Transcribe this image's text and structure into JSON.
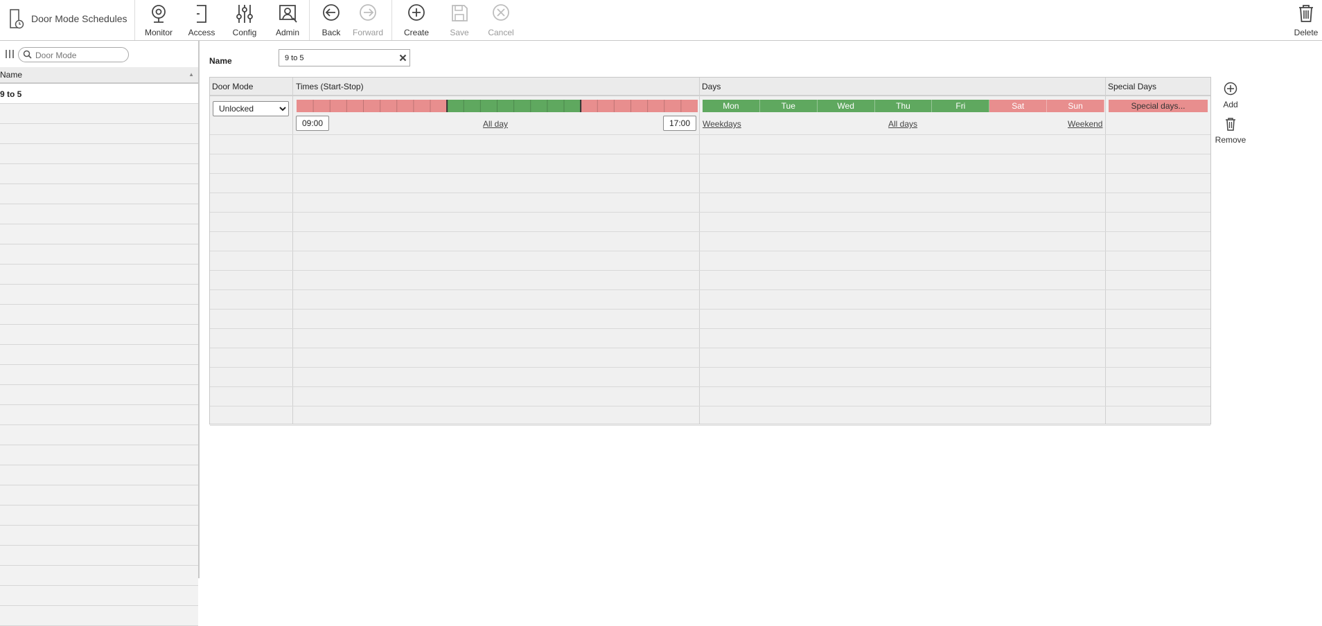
{
  "app": {
    "title": "Door Mode Schedules"
  },
  "toolbar": {
    "monitor": "Monitor",
    "access": "Access",
    "config": "Config",
    "admin": "Admin",
    "back": "Back",
    "forward": "Forward",
    "create": "Create",
    "save": "Save",
    "cancel": "Cancel",
    "delete": "Delete"
  },
  "left": {
    "search_placeholder": "Door Mode",
    "column_header": "Name",
    "rows": [
      "9 to 5"
    ]
  },
  "form": {
    "name_label": "Name",
    "name_value": "9 to 5"
  },
  "grid": {
    "headers": {
      "door_mode": "Door Mode",
      "times": "Times (Start-Stop)",
      "days": "Days",
      "special_days": "Special Days"
    },
    "row": {
      "door_mode": "Unlocked",
      "door_mode_options": [
        "Unlocked"
      ],
      "start": "09:00",
      "stop": "17:00",
      "all_day": "All day",
      "weekdays": "Weekdays",
      "all_days": "All days",
      "weekend": "Weekend",
      "special_days_button": "Special days...",
      "days": [
        {
          "label": "Mon",
          "active": true
        },
        {
          "label": "Tue",
          "active": true
        },
        {
          "label": "Wed",
          "active": true
        },
        {
          "label": "Thu",
          "active": true
        },
        {
          "label": "Fri",
          "active": true
        },
        {
          "label": "Sat",
          "active": false
        },
        {
          "label": "Sun",
          "active": false
        }
      ]
    }
  },
  "side": {
    "add": "Add",
    "remove": "Remove"
  },
  "colors": {
    "active": "#5fa85f",
    "inactive": "#e88e8e"
  }
}
